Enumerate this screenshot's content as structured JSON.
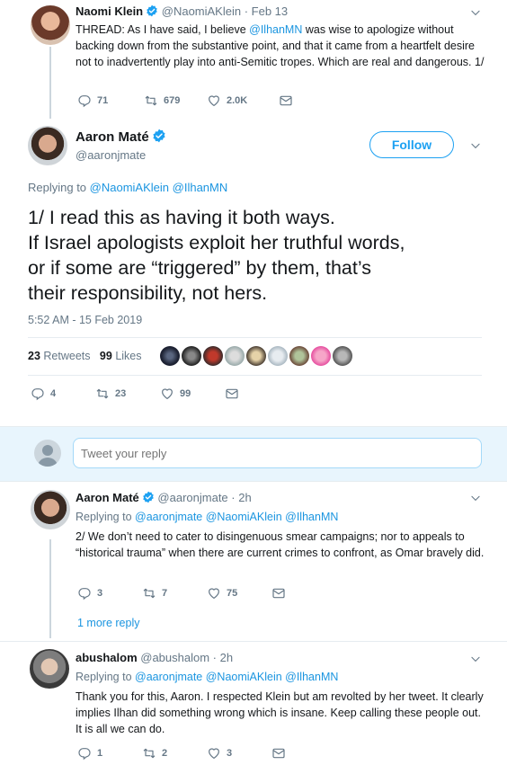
{
  "parent_tweet": {
    "name": "Naomi Klein",
    "handle": "@NaomiAKlein",
    "time": "· Feb 13",
    "text_pre": "THREAD: As I have said, I believe ",
    "mention": "@IlhanMN",
    "text_post": " was wise to apologize without backing down from the substantive point, and that it came from a heartfelt desire not to inadvertently play into anti-Semitic tropes. Which are real and dangerous. 1/",
    "replies": "71",
    "retweets": "679",
    "likes": "2.0K"
  },
  "main_tweet": {
    "name": "Aaron Maté",
    "handle": "@aaronjmate",
    "follow_label": "Follow",
    "replying_label": "Replying to",
    "replying_to_1": "@NaomiAKlein",
    "replying_to_2": "@IlhanMN",
    "text_lines": [
      "1/ I read this as having it both ways.",
      "If Israel apologists exploit her truthful words,",
      "or if some are “triggered” by them, that’s",
      "their responsibility, not hers."
    ],
    "timestamp": "5:52 AM - 15 Feb 2019",
    "retweet_count": "23",
    "retweet_label": "Retweets",
    "like_count": "99",
    "like_label": "Likes",
    "replies": "4",
    "retweets": "23",
    "likes": "99"
  },
  "reply_box": {
    "placeholder": "Tweet your reply"
  },
  "reply_1": {
    "name": "Aaron Maté",
    "handle": "@aaronjmate",
    "time": "· 2h",
    "replying_label": "Replying to",
    "replying_to": "@aaronjmate @NaomiAKlein @IlhanMN",
    "text": "2/ We don’t need to cater to disingenuous smear campaigns; nor to appeals to “historical trauma” when there are current crimes to confront, as Omar bravely did.",
    "replies": "3",
    "retweets": "7",
    "likes": "75",
    "more_replies": "1 more reply"
  },
  "reply_2": {
    "name": "abushalom",
    "handle": "@abushalom",
    "time": "· 2h",
    "replying_label": "Replying to",
    "replying_to": "@aaronjmate @NaomiAKlein @IlhanMN",
    "text": "Thank you for this, Aaron.  I respected Klein but am revolted by her tweet.  It clearly implies Ilhan did something wrong which is insane.  Keep calling these people out.  It is all we can do.",
    "replies": "1",
    "retweets": "2",
    "likes": "3"
  },
  "colors": {
    "accent": "#1b95e0",
    "verified": "#1da1f2",
    "muted": "#657786",
    "border": "#e6ecf0"
  }
}
